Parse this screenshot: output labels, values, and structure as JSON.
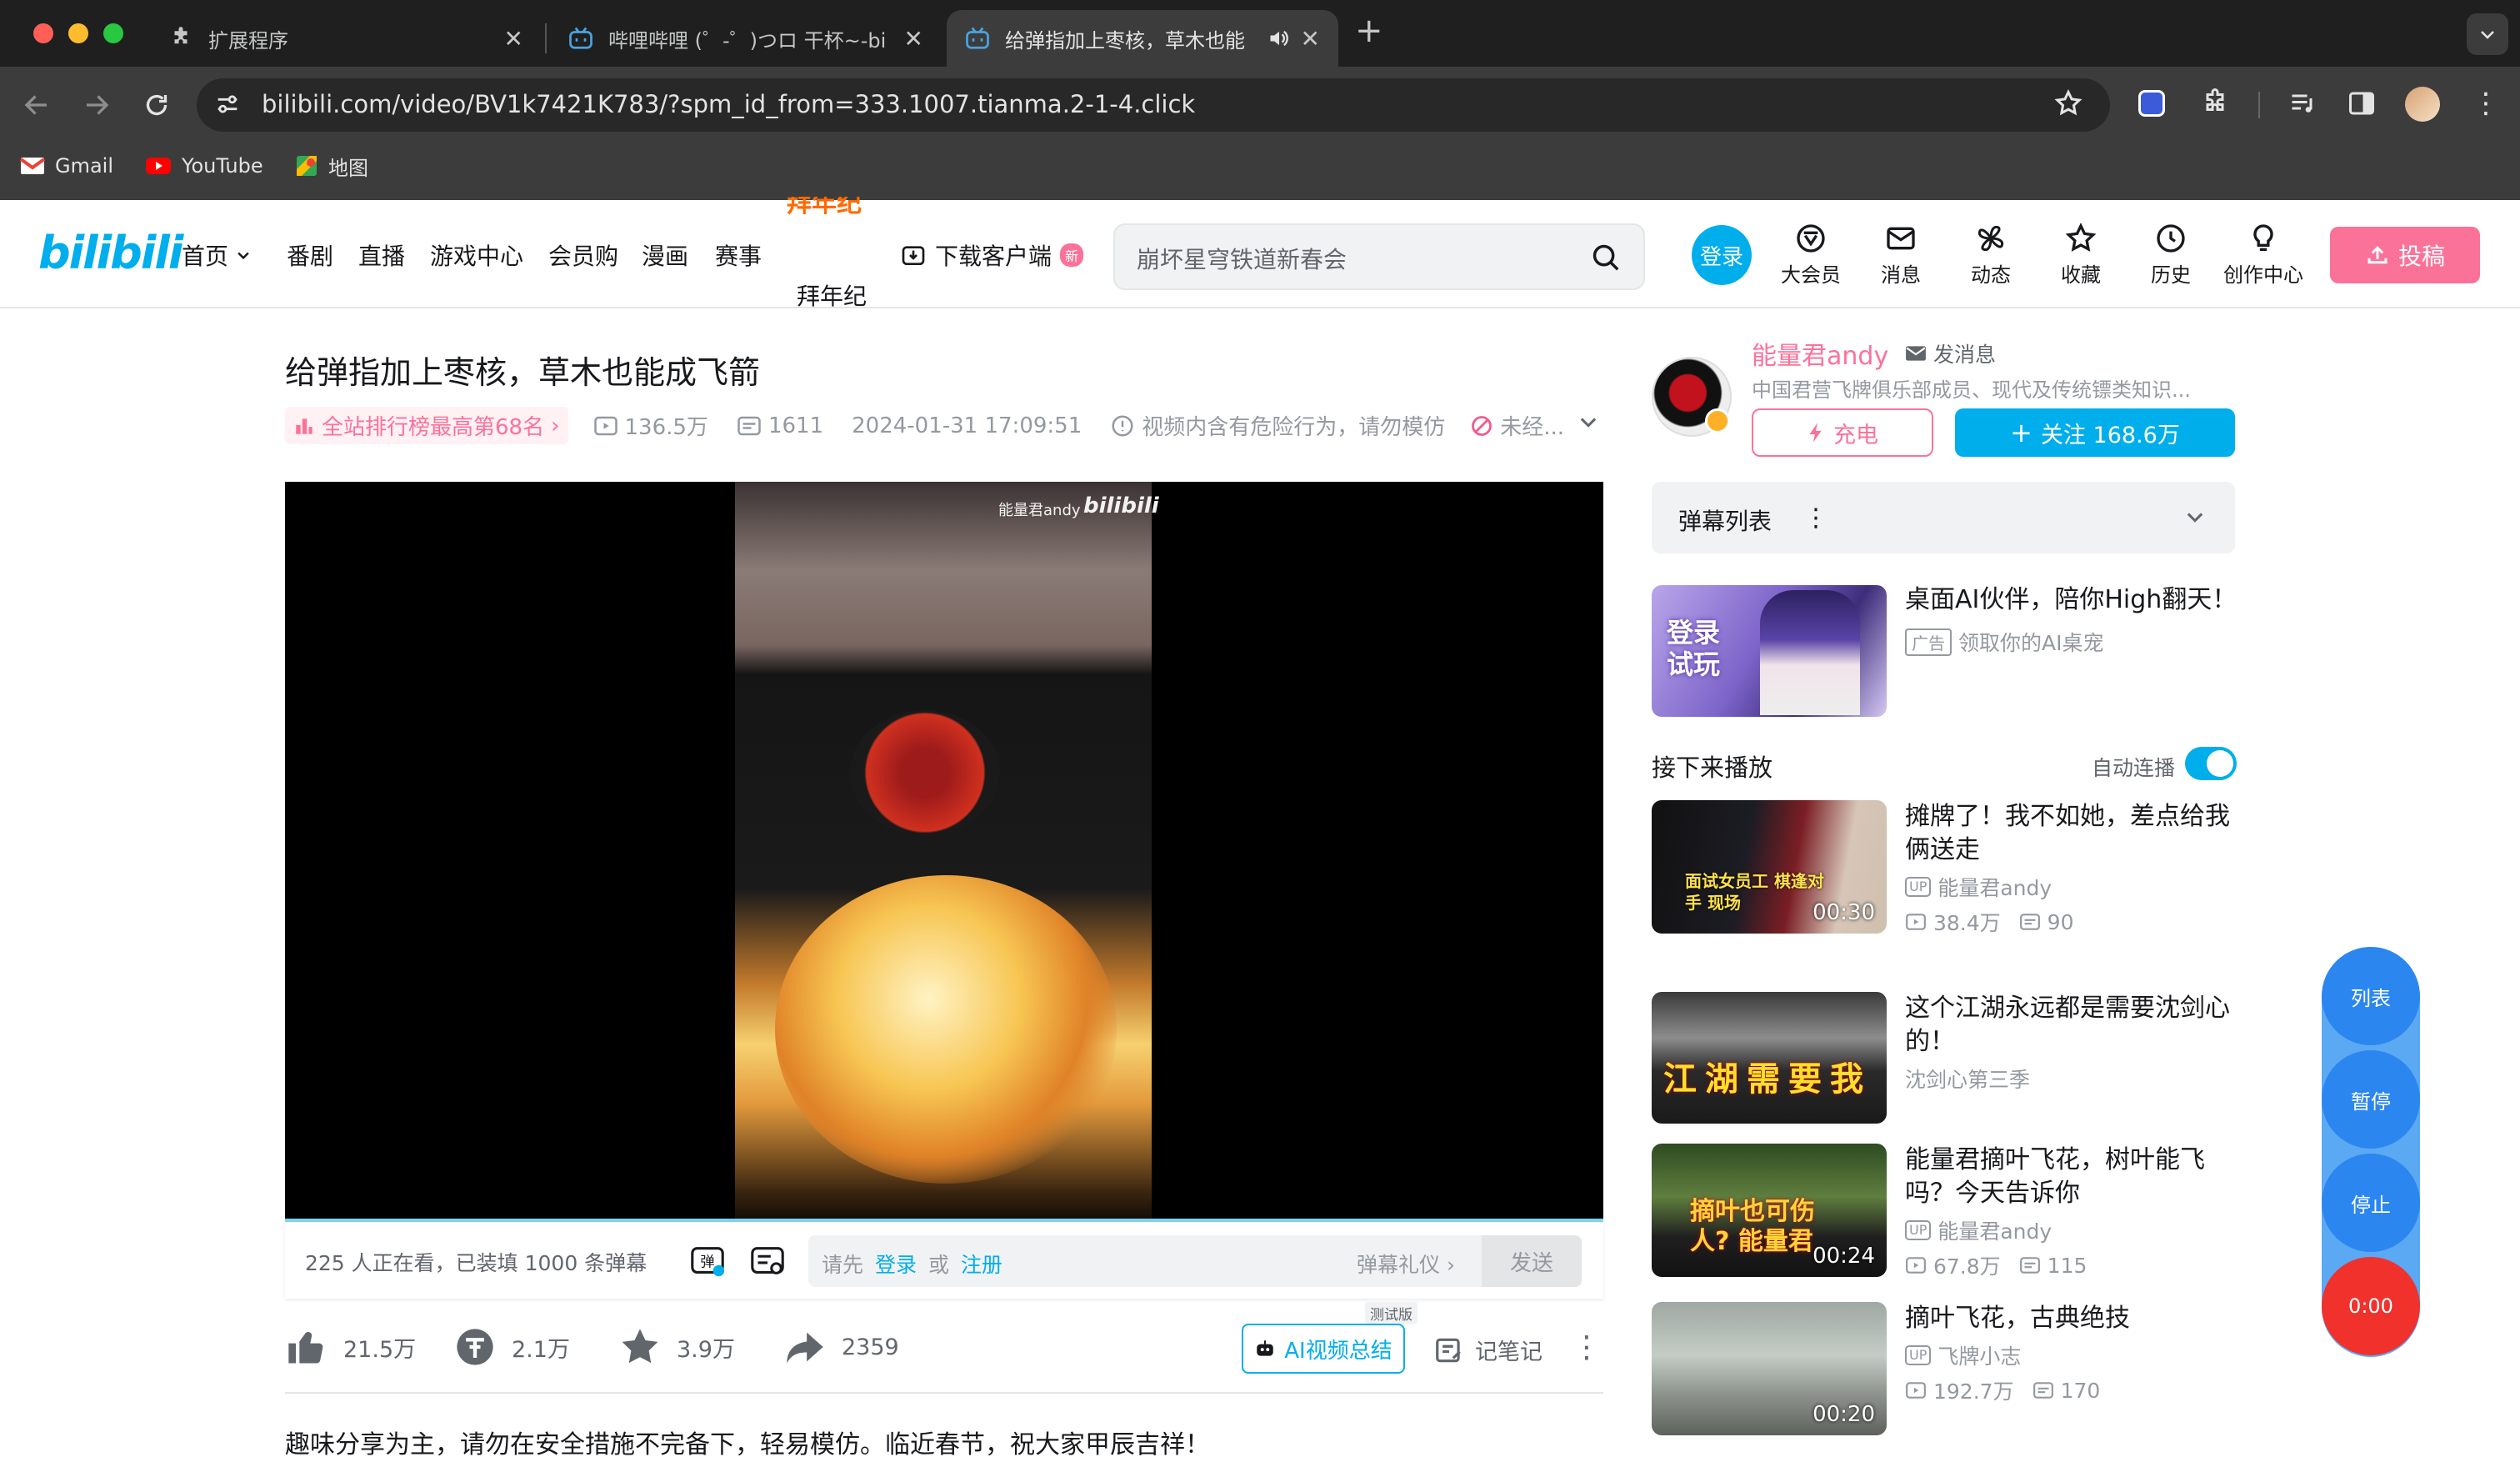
{
  "browser": {
    "tabs": [
      {
        "title": "扩展程序",
        "icon": "puzzle-icon"
      },
      {
        "title": "哔哩哔哩 (゜-゜)つロ 干杯~-bi",
        "icon": "bilibili-tab-icon"
      },
      {
        "title": "给弹指加上枣核，草木也能",
        "icon": "bilibili-tab-icon"
      }
    ],
    "url": "bilibili.com/video/BV1k7421K783/?spm_id_from=333.1007.tianma.2-1-4.click",
    "bookmarks": [
      "Gmail",
      "YouTube",
      "地图"
    ]
  },
  "header": {
    "logo": "bilibili",
    "nav": [
      "首页",
      "番剧",
      "直播",
      "游戏中心",
      "会员购",
      "漫画",
      "赛事",
      "拜年纪"
    ],
    "download": "下载客户端",
    "new_badge": "新",
    "search_placeholder": "崩坏星穹铁道新春会",
    "login": "登录",
    "icons": [
      "大会员",
      "消息",
      "动态",
      "收藏",
      "历史",
      "创作中心"
    ],
    "upload": "投稿",
    "accent": "#fb7299",
    "brand_blue": "#00aeec"
  },
  "video": {
    "title": "给弹指加上枣核，草木也能成飞箭",
    "rank": "全站排行榜最高第68名",
    "views": "136.5万",
    "danmaku_count": "1611",
    "date": "2024-01-31 17:09:51",
    "warning": "视频内含有危险行为，请勿模仿",
    "reprint": "未经...",
    "watermark": "能量君andy",
    "watching": "225 人正在看，已装填 1000 条弹幕",
    "danmaku_prompt": "请先",
    "danmaku_login": "登录",
    "danmaku_or": "或",
    "danmaku_register": "注册",
    "danmaku_etiquette": "弹幕礼仪",
    "send": "发送",
    "likes": "21.5万",
    "coins": "2.1万",
    "favorites": "3.9万",
    "shares": "2359",
    "beta": "测试版",
    "ai_summary": "AI视频总结",
    "notes": "记笔记",
    "description": "趣味分享为主，请勿在安全措施不完备下，轻易模仿。临近春节，祝大家甲辰吉祥！"
  },
  "uploader": {
    "name": "能量君andy",
    "message": "发消息",
    "bio": "中国君营飞牌俱乐部成员、现代及传统镖类知识...",
    "charge": "充电",
    "follow": "关注 168.6万"
  },
  "danmaku_list": "弹幕列表",
  "ad": {
    "title": "桌面AI伙伴，陪你High翻天！",
    "tag": "广告",
    "sub": "领取你的AI桌宠",
    "thumb_text": "登录试玩"
  },
  "next_up": {
    "label": "接下来播放",
    "autoplay": "自动连播",
    "autoplay_on": true
  },
  "recommendations": [
    {
      "title": "摊牌了！我不如她，差点给我俩送走",
      "author": "能量君andy",
      "views": "38.4万",
      "danmaku": "90",
      "duration": "00:30",
      "thumb_text": "面试女员工 棋逢对手 现场"
    },
    {
      "title": "这个江湖永远都是需要沈剑心的！",
      "author": "沈剑心第三季",
      "views": "",
      "danmaku": "",
      "duration": "",
      "thumb_text": "江湖需要我"
    },
    {
      "title": "能量君摘叶飞花，树叶能飞吗？今天告诉你",
      "author": "能量君andy",
      "views": "67.8万",
      "danmaku": "115",
      "duration": "00:24",
      "thumb_text": "摘叶也可伤人? 能量君"
    },
    {
      "title": "摘叶飞花，古典绝技",
      "author": "飞牌小志",
      "views": "192.7万",
      "danmaku": "170",
      "duration": "00:20",
      "thumb_text": ""
    }
  ],
  "float_controls": [
    "列表",
    "暂停",
    "停止",
    "0:00"
  ]
}
